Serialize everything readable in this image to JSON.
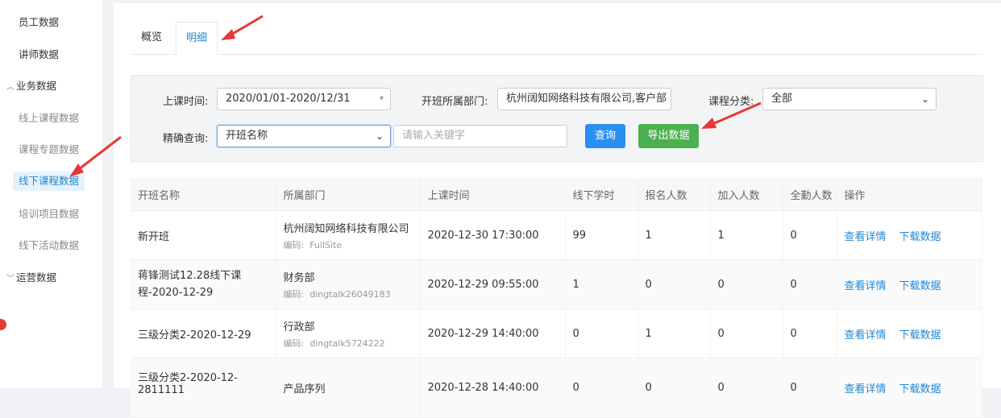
{
  "sidebar": {
    "items": [
      {
        "label": "员工数据"
      },
      {
        "label": "讲师数据"
      },
      {
        "label": "业务数据"
      },
      {
        "label": "线上课程数据"
      },
      {
        "label": "课程专题数据"
      },
      {
        "label": "线下课程数据"
      },
      {
        "label": "培训项目数据"
      },
      {
        "label": "线下活动数据"
      },
      {
        "label": "运营数据"
      }
    ]
  },
  "tabs": [
    {
      "label": "概览"
    },
    {
      "label": "明细"
    }
  ],
  "filters": {
    "time_label": "上课时间:",
    "time_value": "2020/01/01-2020/12/31",
    "dept_label": "开班所属部门:",
    "dept_value": "杭州阔知网络科技有限公司,客户部",
    "category_label": "课程分类:",
    "category_value": "全部",
    "precise_label": "精确查询:",
    "precise_value": "开班名称",
    "keyword_placeholder": "请输入关键字",
    "query_button": "查询",
    "export_button": "导出数据"
  },
  "table": {
    "headers": [
      "开班名称",
      "所属部门",
      "上课时间",
      "线下学时",
      "报名人数",
      "加入人数",
      "全勤人数",
      "操作"
    ],
    "code_label": "编码:",
    "rows": [
      {
        "name": "新开班",
        "dept": "杭州阔知网络科技有限公司",
        "code": "FullSite",
        "time": "2020-12-30 17:30:00",
        "hours": "99",
        "signup": "1",
        "joined": "1",
        "full": "0",
        "view": "查看详情",
        "download": "下载数据"
      },
      {
        "name": "蒋锋测试12.28线下课程-2020-12-29",
        "dept": "财务部",
        "code": "dingtalk26049183",
        "time": "2020-12-29 09:55:00",
        "hours": "1",
        "signup": "0",
        "joined": "0",
        "full": "0",
        "view": "查看详情",
        "download": "下载数据"
      },
      {
        "name": "三级分类2-2020-12-29",
        "dept": "行政部",
        "code": "dingtalk5724222",
        "time": "2020-12-29 14:40:00",
        "hours": "0",
        "signup": "1",
        "joined": "0",
        "full": "0",
        "view": "查看详情",
        "download": "下载数据"
      },
      {
        "name": "三级分类2-2020-12-2811111",
        "dept": "产品序列",
        "code": "",
        "time": "2020-12-28 14:40:00",
        "hours": "0",
        "signup": "0",
        "joined": "0",
        "full": "0",
        "view": "查看详情",
        "download": "下载数据"
      }
    ]
  },
  "colors": {
    "accent": "#1e88d6",
    "export": "#4caf50",
    "query": "#2a8ff0",
    "annotation_arrow": "#e53935"
  }
}
